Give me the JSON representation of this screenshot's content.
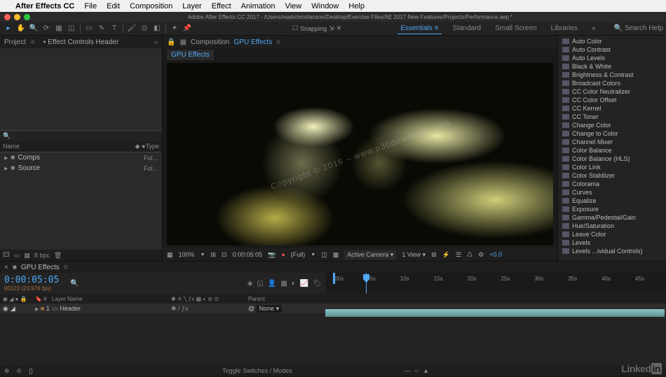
{
  "mac_menu": {
    "app": "After Effects CC",
    "items": [
      "File",
      "Edit",
      "Composition",
      "Layer",
      "Effect",
      "Animation",
      "View",
      "Window",
      "Help"
    ]
  },
  "window_path": "Adobe After Effects CC 2017 - /Users/markchristianson/Desktop/Exercise Files/AE 2017 New Features/Projects/Performance.aep *",
  "snapping_label": "Snapping",
  "workspaces": {
    "active": "Essentials",
    "items": [
      "Essentials",
      "Standard",
      "Small Screen",
      "Libraries"
    ]
  },
  "search_help_placeholder": "Search Help",
  "project_panel": {
    "tab": "Project",
    "effect_controls": "Effect Controls Header",
    "columns": {
      "name": "Name",
      "type": "Type"
    },
    "items": [
      {
        "name": "Comps",
        "type": "Fol..."
      },
      {
        "name": "Source",
        "type": "Fol..."
      }
    ],
    "bpc": "8 bpc"
  },
  "viewer": {
    "label": "Composition",
    "comp_name": "GPU Effects",
    "sub_tab": "GPU Effects",
    "zoom": "100%",
    "timecode": "0:00:05:05",
    "resolution": "(Full)",
    "camera": "Active Camera",
    "views": "1 View",
    "exposure": "+0.0"
  },
  "effects_list": [
    "Auto Color",
    "Auto Contrast",
    "Auto Levels",
    "Black & White",
    "Brightness & Contrast",
    "Broadcast Colors",
    "CC Color Neutralizer",
    "CC Color Offset",
    "CC Kernel",
    "CC Toner",
    "Change Color",
    "Change to Color",
    "Channel Mixer",
    "Color Balance",
    "Color Balance (HLS)",
    "Color Link",
    "Color Stabilizer",
    "Colorama",
    "Curves",
    "Equalize",
    "Exposure",
    "Gamma/Pedestal/Gain",
    "Hue/Saturation",
    "Leave Color",
    "Levels",
    "Levels ...ividual Controls)"
  ],
  "timeline": {
    "comp_name": "GPU Effects",
    "timecode": "0:00:05:05",
    "frames": "00123 (23.976 fps)",
    "col_layer_name": "Layer Name",
    "col_parent": "Parent",
    "layer": {
      "num": "1",
      "name": "Header",
      "parent": "None"
    },
    "ruler": [
      ":00s",
      "05s",
      "10s",
      "15s",
      "20s",
      "25s",
      "30s",
      "35s",
      "40s",
      "45s"
    ],
    "toggle_label": "Toggle Switches / Modes"
  },
  "watermark": "Copyright © 2016 – www.p30download.com",
  "linkedin": {
    "linked": "Linked",
    "in": "in"
  }
}
